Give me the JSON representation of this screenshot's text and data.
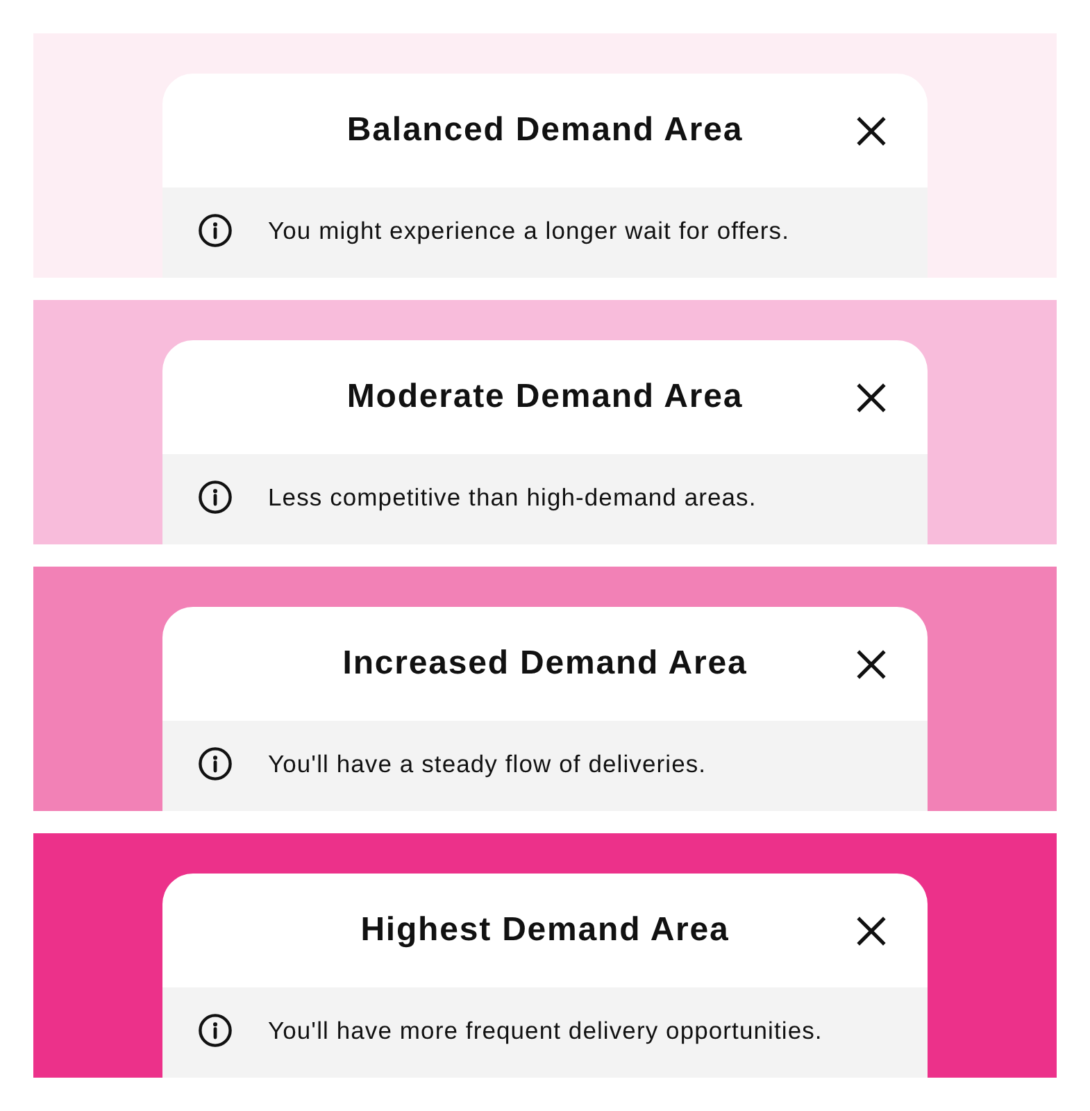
{
  "panels": [
    {
      "color": "#fdeef4",
      "title": "Balanced Demand Area",
      "message": "You might experience a longer wait for offers."
    },
    {
      "color": "#f8bcdb",
      "title": "Moderate Demand Area",
      "message": "Less competitive than high-demand areas."
    },
    {
      "color": "#f281b6",
      "title": "Increased Demand Area",
      "message": "You'll have a steady flow of deliveries."
    },
    {
      "color": "#ec318a",
      "title": "Highest Demand Area",
      "message": "You'll have more frequent delivery opportunities."
    }
  ]
}
